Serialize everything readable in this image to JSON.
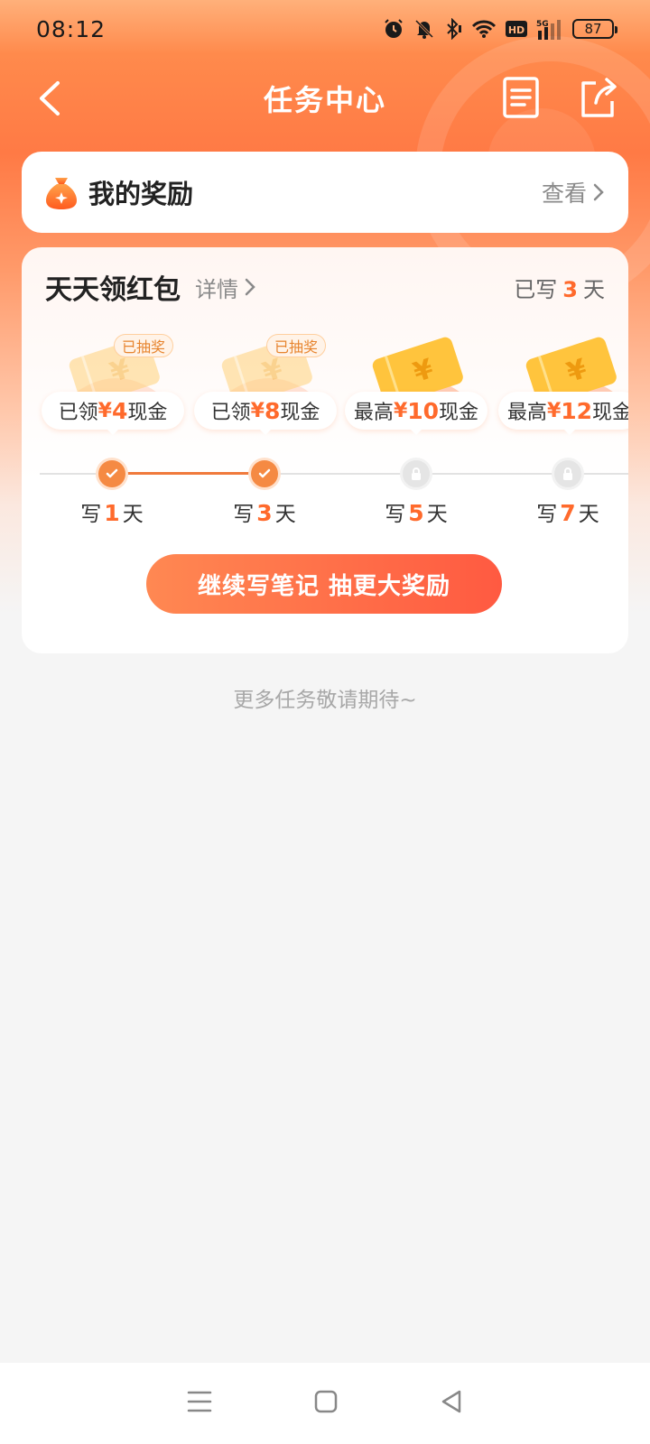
{
  "status_bar": {
    "time": "08:12",
    "battery": "87",
    "icons": [
      "alarm-icon",
      "mute-icon",
      "bluetooth-icon",
      "wifi-icon",
      "hd-icon",
      "signal-5g-icon",
      "battery-icon"
    ]
  },
  "header": {
    "title": "任务中心",
    "back_icon": "chevron-left-icon",
    "actions": [
      "document-icon",
      "share-icon"
    ]
  },
  "reward_card": {
    "icon": "money-bag-icon",
    "title": "我的奖励",
    "view_label": "查看"
  },
  "daily_card": {
    "title": "天天领红包",
    "details_label": "详情",
    "written_prefix": "已写",
    "written_days": "3",
    "written_suffix": "天",
    "coupons": [
      {
        "prefix": "已领",
        "currency": "¥",
        "amount": "4",
        "suffix": "现金",
        "tag": "已抽奖",
        "claimed": true
      },
      {
        "prefix": "已领",
        "currency": "¥",
        "amount": "8",
        "suffix": "现金",
        "tag": "已抽奖",
        "claimed": true
      },
      {
        "prefix": "最高",
        "currency": "¥",
        "amount": "10",
        "suffix": "现金",
        "tag": "",
        "claimed": false
      },
      {
        "prefix": "最高",
        "currency": "¥",
        "amount": "12",
        "suffix": "现金",
        "tag": "",
        "claimed": false
      }
    ],
    "progress": [
      {
        "prefix": "写",
        "day": "1",
        "suffix": "天",
        "state": "done"
      },
      {
        "prefix": "写",
        "day": "3",
        "suffix": "天",
        "state": "done"
      },
      {
        "prefix": "写",
        "day": "5",
        "suffix": "天",
        "state": "locked"
      },
      {
        "prefix": "写",
        "day": "7",
        "suffix": "天",
        "state": "locked"
      }
    ],
    "cta_label": "继续写笔记 抽更大奖励"
  },
  "footer_note": "更多任务敬请期待~",
  "nav_bar": {
    "buttons": [
      "menu-icon",
      "home-square-icon",
      "back-triangle-icon"
    ]
  },
  "colors": {
    "accent": "#ff6a2c",
    "header_gradient_top": "#ff8a4c",
    "cta_start": "#ff8852",
    "cta_end": "#ff5a41",
    "page_bg": "#f5f5f5"
  }
}
